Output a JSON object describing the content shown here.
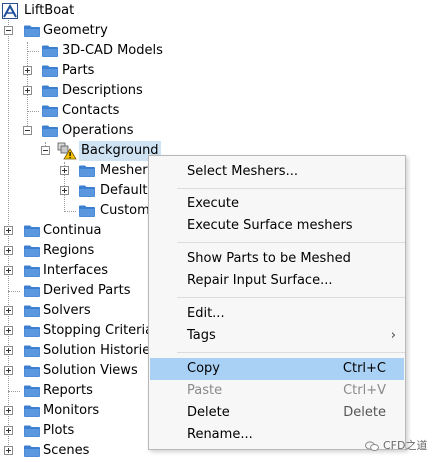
{
  "tree": {
    "root": "LiftBoat",
    "geometry": "Geometry",
    "geometry_children": [
      "3D-CAD Models",
      "Parts",
      "Descriptions",
      "Contacts",
      "Operations"
    ],
    "operations_child": "Background",
    "background_children": [
      "Meshers",
      "Default",
      "Custom"
    ],
    "top_level": [
      "Continua",
      "Regions",
      "Interfaces",
      "Derived Parts",
      "Solvers",
      "Stopping Criteria",
      "Solution Histories",
      "Solution Views",
      "Reports",
      "Monitors",
      "Plots",
      "Scenes"
    ]
  },
  "context_menu": {
    "items": [
      {
        "label": "Select Meshers...",
        "shortcut": ""
      },
      {
        "label": "Execute",
        "shortcut": ""
      },
      {
        "label": "Execute Surface meshers",
        "shortcut": ""
      },
      {
        "label": "Show Parts to be Meshed",
        "shortcut": ""
      },
      {
        "label": "Repair Input Surface...",
        "shortcut": ""
      },
      {
        "label": "Edit...",
        "shortcut": ""
      },
      {
        "label": "Tags",
        "shortcut": "",
        "submenu_arrow": "›"
      },
      {
        "label": "Copy",
        "shortcut": "Ctrl+C",
        "highlighted": true
      },
      {
        "label": "Paste",
        "shortcut": "Ctrl+V",
        "disabled": true
      },
      {
        "label": "Delete",
        "shortcut": "Delete"
      },
      {
        "label": "Rename...",
        "shortcut": ""
      }
    ]
  },
  "watermark": "CFD之道",
  "colors": {
    "folder_fill": "#3c7fd0",
    "folder_light": "#6fa8e6",
    "selection": "#cfe3f3",
    "menu_highlight": "#a9d1f5",
    "warning": "#f2c200"
  }
}
